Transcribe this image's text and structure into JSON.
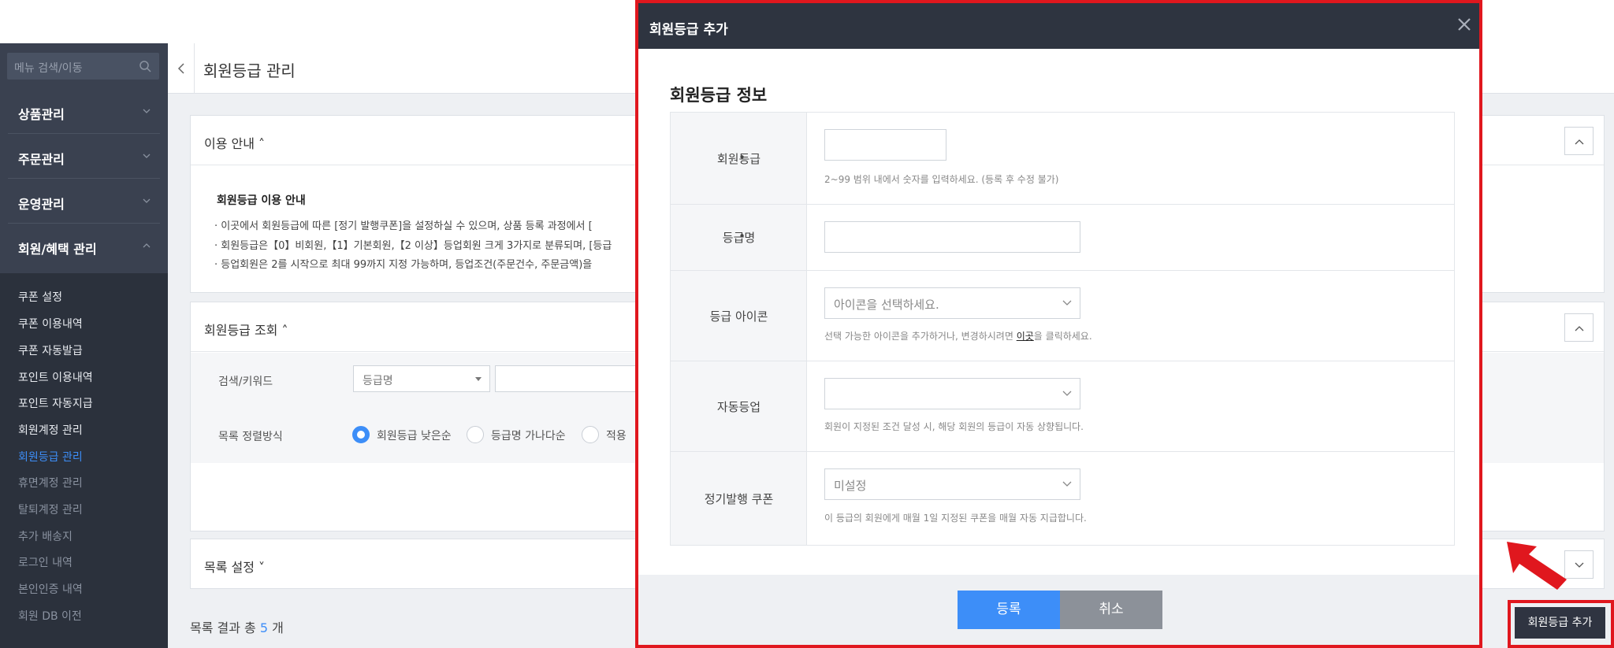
{
  "sidebar": {
    "search_placeholder": "메뉴 검색/이동",
    "menus": [
      {
        "label": "상품관리"
      },
      {
        "label": "주문관리"
      },
      {
        "label": "운영관리"
      },
      {
        "label": "회원/혜택 관리"
      }
    ],
    "sub_items": [
      {
        "label": "쿠폰 설정",
        "state": "normal"
      },
      {
        "label": "쿠폰 이용내역",
        "state": "normal"
      },
      {
        "label": "쿠폰 자동발급",
        "state": "normal"
      },
      {
        "label": "포인트 이용내역",
        "state": "normal"
      },
      {
        "label": "포인트 자동지급",
        "state": "normal"
      },
      {
        "label": "회원계정 관리",
        "state": "normal"
      },
      {
        "label": "회원등급 관리",
        "state": "active"
      },
      {
        "label": "휴면계정 관리",
        "state": "dim"
      },
      {
        "label": "탈퇴계정 관리",
        "state": "dim"
      },
      {
        "label": "추가 배송지",
        "state": "dim"
      },
      {
        "label": "로그인 내역",
        "state": "dim"
      },
      {
        "label": "본인인증 내역",
        "state": "dim"
      },
      {
        "label": "회원 DB 이전",
        "state": "dim"
      }
    ]
  },
  "page": {
    "title": "회원등급 관리",
    "guide_panel": {
      "title": "이용 안내 ˄",
      "heading": "회원등급 이용 안내",
      "lines": [
        "· 이곳에서 회원등급에 따른 [정기 발행쿠폰]을 설정하실 수 있으며, 상품 등록 과정에서 [",
        "· 회원등급은【0】비회원,【1】기본회원,【2 이상】등업회원 크게 3가지로 분류되며, [등급",
        "· 등업회원은 2를 시작으로 최대 99까지 지정 가능하며, 등업조건(주문건수, 주문금액)을"
      ]
    },
    "search_panel": {
      "title": "회원등급 조회 ˄",
      "keyword_label": "검색/키워드",
      "keyword_select": "등급명",
      "sort_label": "목록 정렬방식",
      "sort_options": [
        "회원등급 낮은순",
        "등급명 가나다순",
        "적용"
      ]
    },
    "list_panel": {
      "title": "목록 설정 ˅"
    },
    "result": {
      "prefix": "목록 결과 총 ",
      "count": "5",
      "suffix": " 개"
    },
    "add_button": "회원등급 추가"
  },
  "modal": {
    "title": "회원등급 추가",
    "section_title": "회원등급 정보",
    "rows": {
      "grade": {
        "label": "회원등급",
        "help": "2~99 범위 내에서 숫자를 입력하세요. (등록 후 수정 불가)"
      },
      "name": {
        "label": "등급명"
      },
      "icon": {
        "label": "등급 아이콘",
        "select": "아이콘을 선택하세요.",
        "help_before": "선택 가능한 아이콘을 추가하거나, 변경하시려면 ",
        "help_link": "이곳",
        "help_after": "을 클릭하세요."
      },
      "auto_upgrade": {
        "label": "자동등업",
        "select": "",
        "help": "회원이 지정된 조건 달성 시, 해당 회원의 등급이 자동 상향됩니다."
      },
      "coupon": {
        "label": "정기발행 쿠폰",
        "select": "미설정",
        "help": "이 등급의 회원에게 매월 1일 지정된 쿠폰을 매월 자동 지급합니다."
      }
    },
    "register_button": "등록",
    "cancel_button": "취소"
  },
  "colors": {
    "accent": "#3d8ef8",
    "highlight_red": "#e0171e",
    "sidebar_bg": "#3a4150",
    "modal_header": "#2e3440"
  }
}
